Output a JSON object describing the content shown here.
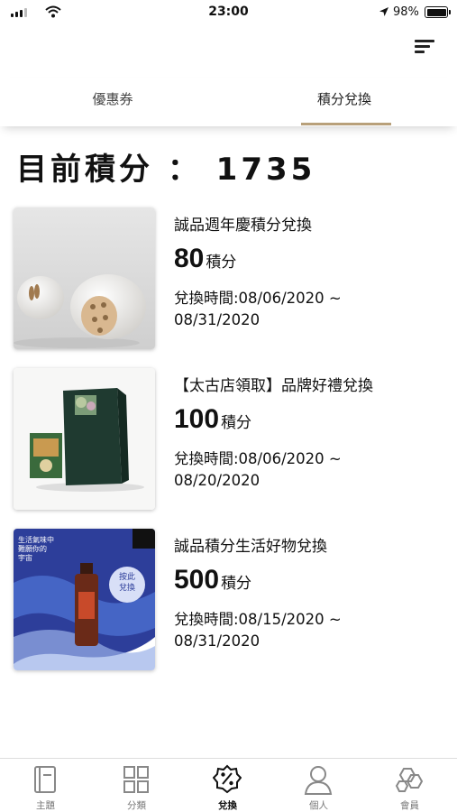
{
  "status_bar": {
    "time": "23:00",
    "battery": "98%"
  },
  "tabs": [
    {
      "label": "優惠券",
      "active": false
    },
    {
      "label": "積分兌換",
      "active": true
    }
  ],
  "accent_color": "#b8a07a",
  "points_summary": "目前積分 ： 1735",
  "rewards": [
    {
      "title": "誠品週年慶積分兌換",
      "points": "80",
      "unit": "積分",
      "period_line1": "兌換時間:08/06/2020 ~",
      "period_line2": "08/31/2020"
    },
    {
      "title": "【太古店領取】品牌好禮兌換",
      "points": "100",
      "unit": "積分",
      "period_line1": "兌換時間:08/06/2020 ~",
      "period_line2": "08/20/2020"
    },
    {
      "title": "誠品積分生活好物兌換",
      "points": "500",
      "unit": "積分",
      "period_line1": "兌換時間:08/15/2020 ~",
      "period_line2": "08/31/2020",
      "image_text": {
        "top": "生活氣味中\n難願你的\n宇宙",
        "badge": "按此\n兌換"
      }
    }
  ],
  "bottom_nav": [
    {
      "label": "主題",
      "icon": "book-icon"
    },
    {
      "label": "分類",
      "icon": "grid-icon"
    },
    {
      "label": "兌換",
      "icon": "percent-badge-icon",
      "active": true
    },
    {
      "label": "個人",
      "icon": "person-icon"
    },
    {
      "label": "會員",
      "icon": "member-icon"
    }
  ]
}
